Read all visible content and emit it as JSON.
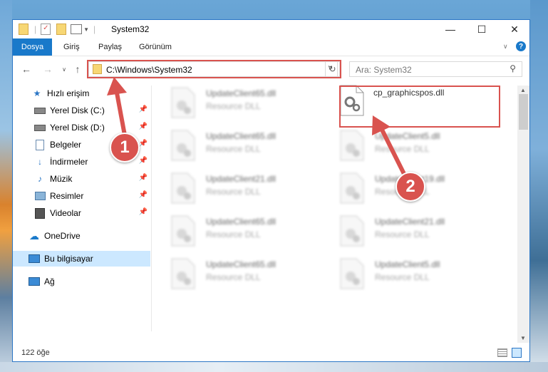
{
  "window": {
    "title": "System32",
    "close": "✕",
    "maximize": "☐",
    "minimize": "—"
  },
  "ribbon": {
    "tabs": [
      "Dosya",
      "Giriş",
      "Paylaş",
      "Görünüm"
    ]
  },
  "address": {
    "path": "C:\\Windows\\System32",
    "search_placeholder": "Ara: System32"
  },
  "sidebar": {
    "items": [
      {
        "label": "Hızlı erişim",
        "icon": "star-icon",
        "pinned": false
      },
      {
        "label": "Yerel Disk (C:)",
        "icon": "drive-icon",
        "pinned": true
      },
      {
        "label": "Yerel Disk (D:)",
        "icon": "drive-icon",
        "pinned": true
      },
      {
        "label": "Belgeler",
        "icon": "document-icon",
        "pinned": true
      },
      {
        "label": "İndirmeler",
        "icon": "download-icon",
        "pinned": true
      },
      {
        "label": "Müzik",
        "icon": "music-icon",
        "pinned": true
      },
      {
        "label": "Resimler",
        "icon": "pictures-icon",
        "pinned": true
      },
      {
        "label": "Videolar",
        "icon": "video-icon",
        "pinned": true
      },
      {
        "label": "OneDrive",
        "icon": "cloud-icon",
        "pinned": false
      },
      {
        "label": "Bu bilgisayar",
        "icon": "computer-icon",
        "pinned": false,
        "selected": true
      },
      {
        "label": "Ağ",
        "icon": "network-icon",
        "pinned": false
      }
    ]
  },
  "files": {
    "left": [
      {
        "name": "UpdateClient65.dll",
        "type": "Resource DLL"
      },
      {
        "name": "UpdateClient65.dll",
        "type": "Resource DLL"
      },
      {
        "name": "UpdateClient21.dll",
        "type": "Resource DLL"
      },
      {
        "name": "UpdateClient65.dll",
        "type": "Resource DLL"
      },
      {
        "name": "UpdateClient65.dll",
        "type": "Resource DLL"
      }
    ],
    "right": [
      {
        "name": "cp_graphicspos.dll",
        "type": "",
        "highlighted": true
      },
      {
        "name": "UpdateClient5.dll",
        "type": "Resource DLL"
      },
      {
        "name": "UpdateClient19.dll",
        "type": "Resource DLL"
      },
      {
        "name": "UpdateClient21.dll",
        "type": "Resource DLL"
      },
      {
        "name": "UpdateClient5.dll",
        "type": "Resource DLL"
      }
    ]
  },
  "status": {
    "count": "122 öğe"
  },
  "callouts": [
    "1",
    "2"
  ],
  "colors": {
    "accent": "#1979ca",
    "highlight": "#d9534f",
    "selection": "#cce8ff"
  }
}
